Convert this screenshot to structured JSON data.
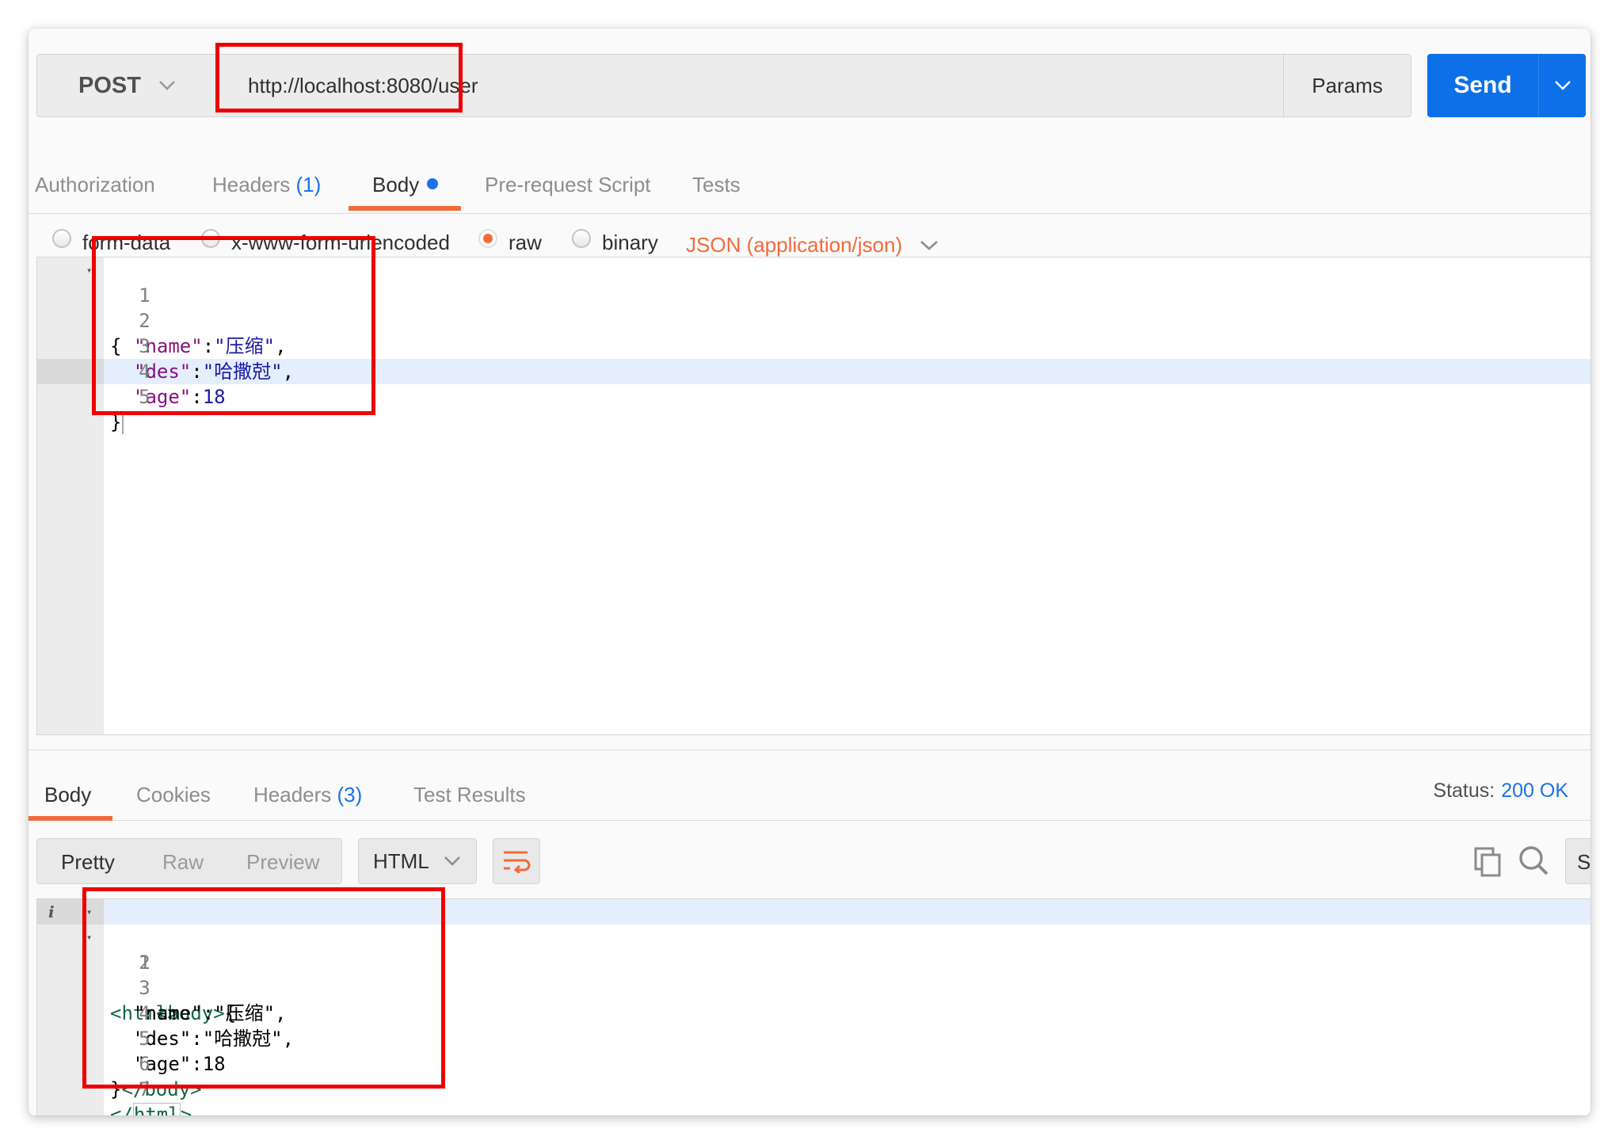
{
  "request": {
    "method": "POST",
    "url": "http://localhost:8080/user",
    "params_label": "Params",
    "send_label": "Send"
  },
  "request_tabs": {
    "authorization": "Authorization",
    "headers": "Headers",
    "headers_count": "(1)",
    "body": "Body",
    "pre_request": "Pre-request Script",
    "tests": "Tests"
  },
  "body_types": {
    "form_data": "form-data",
    "urlencoded": "x-www-form-urlencoded",
    "raw": "raw",
    "binary": "binary",
    "selected": "raw",
    "content_type": "JSON (application/json)"
  },
  "request_body": {
    "line_numbers": [
      "1",
      "2",
      "3",
      "4",
      "5"
    ],
    "open_brace": "{",
    "name_key": "\"name\"",
    "name_value": "\"压缩\"",
    "des_key": "\"des\"",
    "des_value": "\"哈撒尅\"",
    "age_key": "\"age\"",
    "age_value": "18",
    "close_brace": "}",
    "colon": ":",
    "comma": ","
  },
  "response_tabs": {
    "body": "Body",
    "cookies": "Cookies",
    "headers": "Headers",
    "headers_count": "(3)",
    "test_results": "Test Results",
    "status_label": "Status:",
    "status_code": "200 OK"
  },
  "response_toolbar": {
    "pretty": "Pretty",
    "raw": "Raw",
    "preview": "Preview",
    "format": "HTML",
    "save_partial": "S"
  },
  "response_body": {
    "line_numbers": [
      "1",
      "2",
      "3",
      "4",
      "5",
      "6",
      "7"
    ],
    "html_open": "<html>",
    "body_open": "<body>",
    "open_brace": "{",
    "name_line": "\"name\":\"压缩\",",
    "des_line": "\"des\":\"哈撒尅\",",
    "age_line": "\"age\":18",
    "close_brace": "}",
    "body_close": "</body>",
    "html_close_lt": "</",
    "html_close_word": "html",
    "html_close_gt": ">"
  },
  "colors": {
    "accent_orange": "#f26b3a",
    "send_blue": "#0d70e8",
    "link_blue": "#1a73e8",
    "annotation_red": "#ee0000"
  },
  "icons": [
    "chevron-down-icon",
    "wrap-text-icon",
    "copy-icon",
    "search-icon",
    "info-icon",
    "fold-arrow-icon"
  ]
}
